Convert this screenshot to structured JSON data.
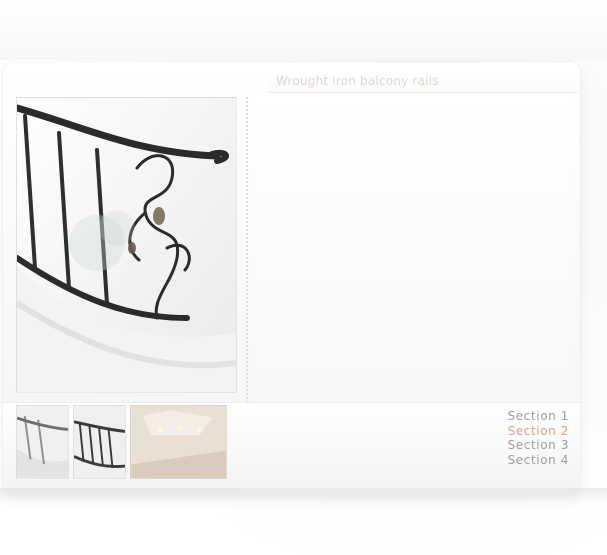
{
  "header": {
    "title": "Wrought iron balcony rails"
  },
  "sections": [
    {
      "label": "Section 1",
      "active": false
    },
    {
      "label": "Section 2",
      "active": true
    },
    {
      "label": "Section 3",
      "active": false
    },
    {
      "label": "Section 4",
      "active": false
    }
  ],
  "colors": {
    "section_default": "#9f9f9f",
    "section_active": "#e0a28b"
  },
  "icons": {
    "main_image": "stair-railing-photo-icon",
    "thumb_1": "stair-thumbnail-icon",
    "thumb_2": "railing-thumbnail-icon",
    "thumb_3": "interior-thumbnail-icon"
  }
}
